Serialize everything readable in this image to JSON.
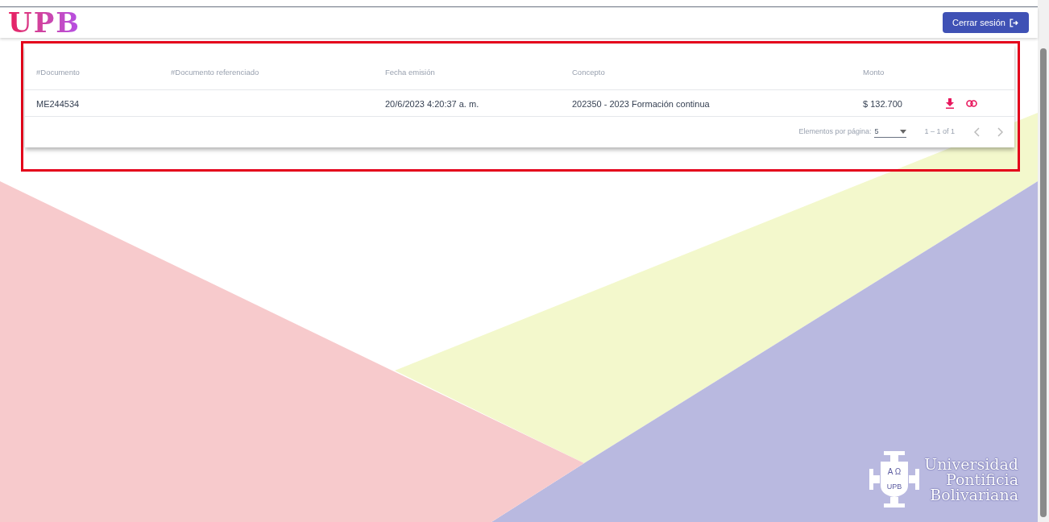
{
  "header": {
    "logo": "UPB",
    "logout_button": "Cerrar sesión"
  },
  "table": {
    "columns": [
      "#Documento",
      "#Documento referenciado",
      "Fecha emisión",
      "Concepto",
      "Monto"
    ],
    "rows": [
      {
        "cells": [
          "ME244534",
          "",
          "20/6/2023 4:20:37 a. m.",
          "202350 - 2023 Formación continua",
          "$ 132.700"
        ]
      }
    ],
    "pagination": {
      "label": "Elementos por página:",
      "page_size": "5",
      "range": "1 – 1 of 1"
    }
  },
  "footer_logo": {
    "crest_top": "Α Ω",
    "crest_bottom": "UPB",
    "lines": [
      "Universidad",
      "Pontificia",
      "Bolivariana"
    ]
  }
}
